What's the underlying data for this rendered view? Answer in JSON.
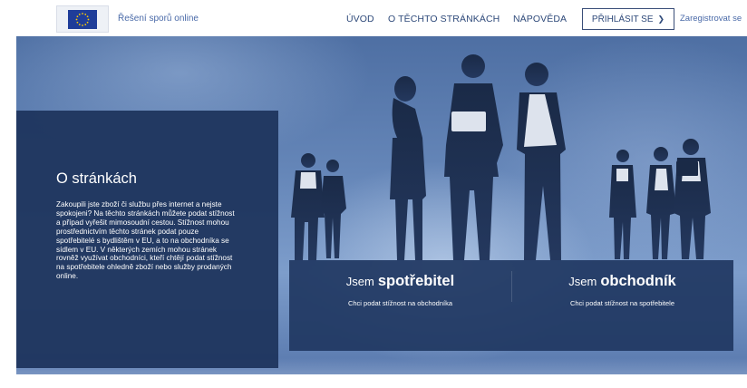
{
  "header": {
    "logo_icon": "eu-flag-icon",
    "site_name": "Řešení sporů online",
    "nav": {
      "uvod": "ÚVOD",
      "about": "O TĚCHTO STRÁNKÁCH",
      "help": "NÁPOVĚDA"
    },
    "login_label": "PŘIHLÁSIT SE",
    "login_icon": "chevron-right-icon",
    "register_label": "Zaregistrovat se"
  },
  "about": {
    "title": "O stránkách",
    "text": "Zakoupili jste zboží či službu přes internet a nejste spokojeni? Na těchto stránkách můžete podat stížnost a případ vyřešit mimosoudní cestou. Stížnost mohou prostřednictvím těchto stránek podat pouze spotřebitelé s bydlištěm v EU, a to na obchodníka se sídlem v EU. V některých zemích mohou stránek rovněž využívat obchodníci, kteří chtějí podat stížnost na spotřebitele ohledně zboží nebo služby prodaných online."
  },
  "choices": {
    "consumer": {
      "prefix": "Jsem",
      "role": "spotřebitel",
      "subtitle": "Chci podat stížnost na obchodníka"
    },
    "merchant": {
      "prefix": "Jsem",
      "role": "obchodník",
      "subtitle": "Chci podat stížnost na spotřebitele"
    }
  },
  "colors": {
    "panel_navy": "#1e345c",
    "nav_text": "#2f4a7a",
    "link_blue": "#4a6aa8",
    "eu_blue": "#1f3d99",
    "eu_gold": "#ffcc00"
  }
}
